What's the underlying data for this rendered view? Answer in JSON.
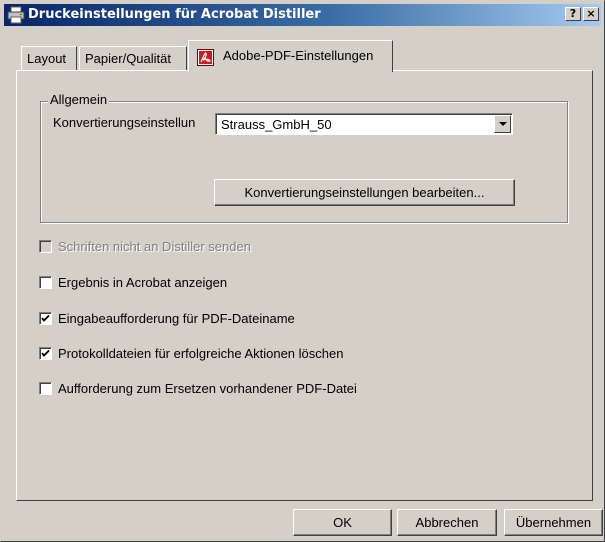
{
  "window": {
    "title": "Druckeinstellungen für Acrobat Distiller",
    "help_button": "?",
    "close_button": "×"
  },
  "tabs": [
    {
      "label": "Layout"
    },
    {
      "label": "Papier/Qualität"
    },
    {
      "label": "Adobe-PDF-Einstellungen",
      "icon": "adobe-pdf-icon"
    }
  ],
  "group": {
    "label": "Allgemein",
    "conversion_label": "Konvertierungseinstellun",
    "conversion_value": "Strauss_GmbH_50",
    "edit_button": "Konvertierungseinstellungen bearbeiten..."
  },
  "options": [
    {
      "label": "Schriften nicht an Distiller senden",
      "checked": false,
      "disabled": true
    },
    {
      "label": "Ergebnis in Acrobat anzeigen",
      "checked": false,
      "disabled": false
    },
    {
      "label": "Eingabeaufforderung für PDF-Dateiname",
      "checked": true,
      "disabled": false
    },
    {
      "label": "Protokolldateien für erfolgreiche Aktionen löschen",
      "checked": true,
      "disabled": false
    },
    {
      "label": "Aufforderung zum Ersetzen vorhandener PDF-Datei",
      "checked": false,
      "disabled": false
    }
  ],
  "footer": {
    "ok": "OK",
    "cancel": "Abbrechen",
    "apply": "Übernehmen"
  },
  "colors": {
    "face": "#d4d0c8",
    "title_start": "#0a246a",
    "title_end": "#a6caf0"
  }
}
